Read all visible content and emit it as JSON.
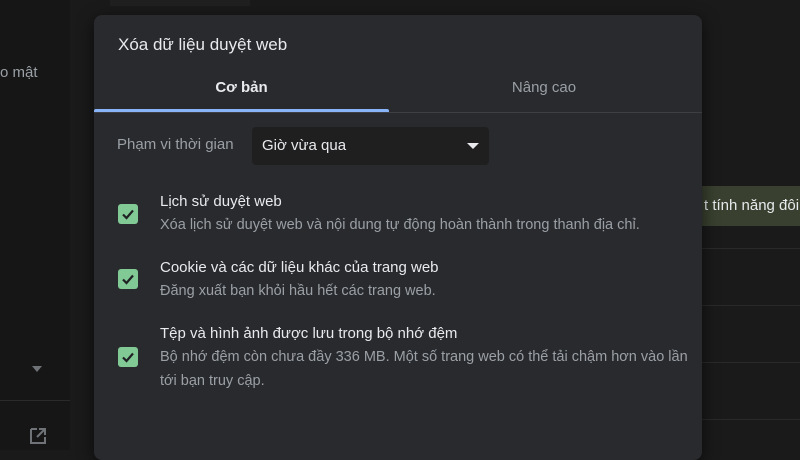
{
  "background": {
    "sidebar_text": "o mật",
    "feature_button": "t tính năng đôi"
  },
  "dialog": {
    "title": "Xóa dữ liệu duyệt web",
    "tabs": [
      {
        "label": "Cơ bản",
        "active": true
      },
      {
        "label": "Nâng cao",
        "active": false
      }
    ],
    "time_range": {
      "label": "Phạm vi thời gian",
      "value": "Giờ vừa qua"
    },
    "options": [
      {
        "title": "Lịch sử duyệt web",
        "description": "Xóa lịch sử duyệt web và nội dung tự động hoàn thành trong thanh địa chỉ.",
        "checked": true
      },
      {
        "title": "Cookie và các dữ liệu khác của trang web",
        "description": "Đăng xuất bạn khỏi hầu hết các trang web.",
        "checked": true
      },
      {
        "title": "Tệp và hình ảnh được lưu trong bộ nhớ đệm",
        "description": "Bộ nhớ đệm còn chưa đầy 336 MB. Một số trang web có thể tải chậm hơn vào lần tới bạn truy cập.",
        "checked": true
      }
    ]
  },
  "colors": {
    "accent": "#8ab4f8",
    "checkbox": "#81c995",
    "dialog_bg": "#292a2d"
  }
}
